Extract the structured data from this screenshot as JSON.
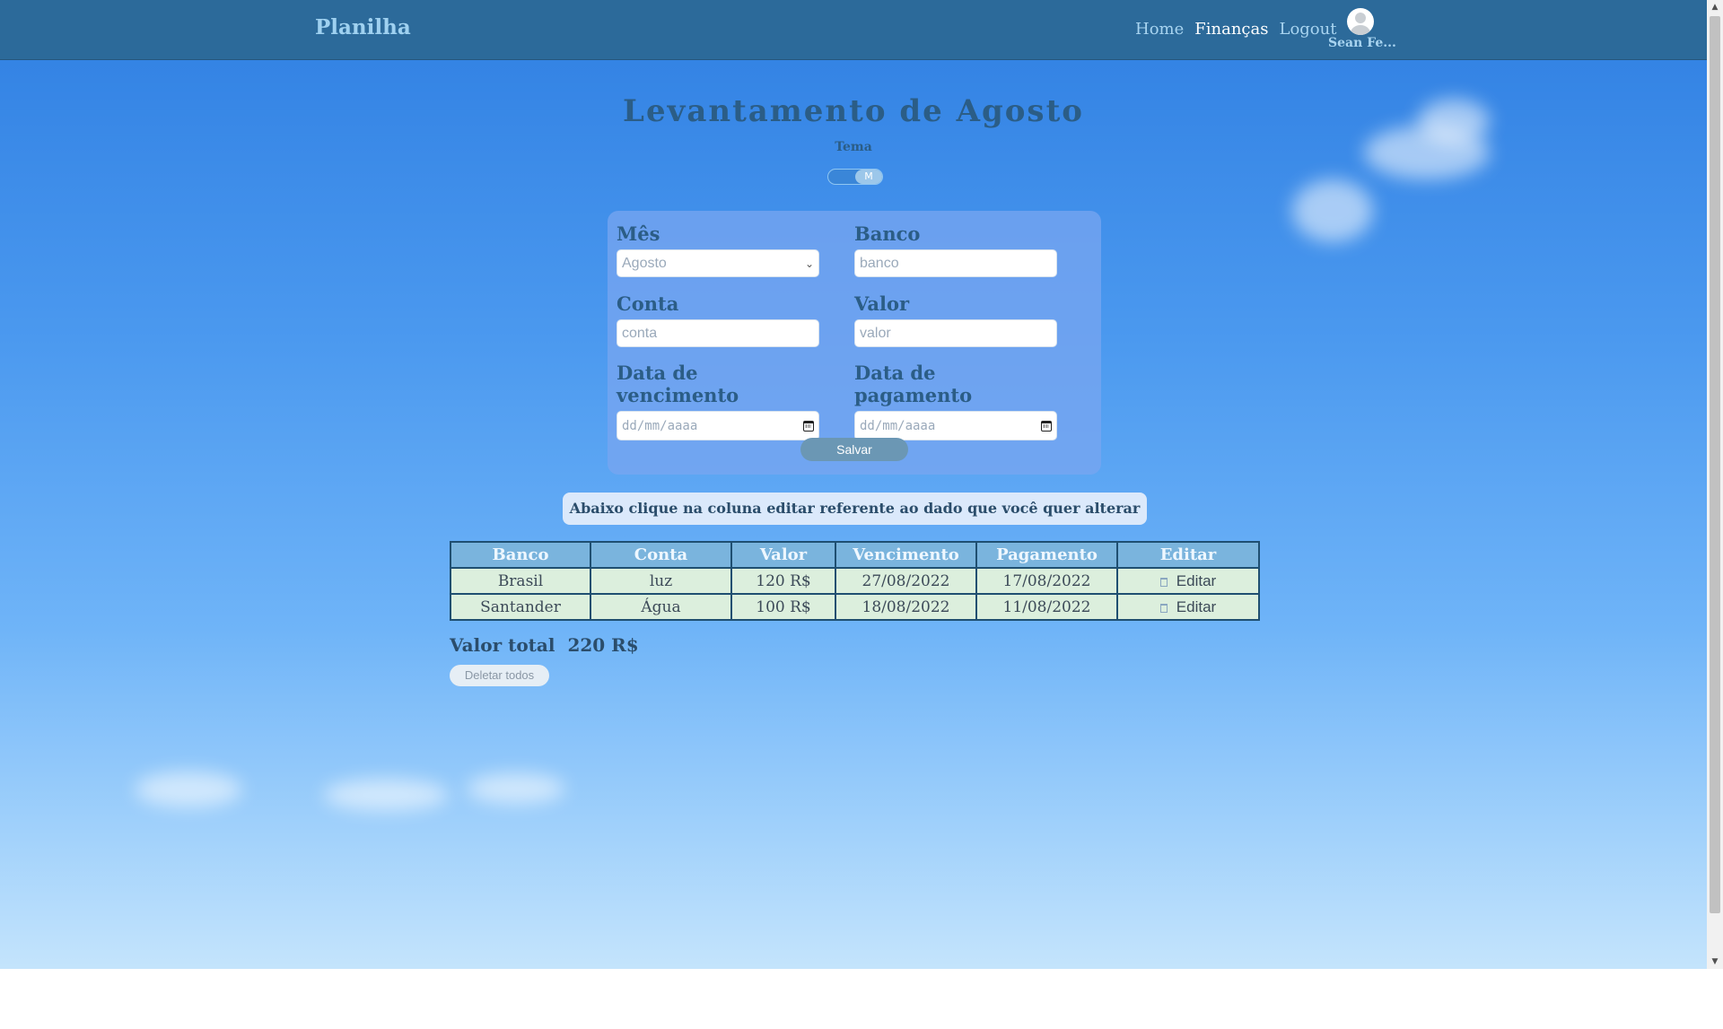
{
  "navbar": {
    "brand": "Planilha",
    "links": [
      "Home",
      "Finanças",
      "Logout"
    ],
    "user_name": "Sean Fe..."
  },
  "page": {
    "title": "Levantamento de Agosto",
    "theme_label": "Tema",
    "theme_toggle_text": "M"
  },
  "form": {
    "month": {
      "label": "Mês",
      "value": "Agosto"
    },
    "bank": {
      "label": "Banco",
      "placeholder": "banco"
    },
    "account": {
      "label": "Conta",
      "placeholder": "conta"
    },
    "value": {
      "label": "Valor",
      "placeholder": "valor"
    },
    "due_date": {
      "label": "Data de vencimento",
      "placeholder": "dd/mm/aaaa"
    },
    "payment_date": {
      "label": "Data de pagamento",
      "placeholder": "dd/mm/aaaa"
    },
    "save_label": "Salvar"
  },
  "hint": "Abaixo clique na coluna editar referente ao dado que você quer alterar",
  "table": {
    "headers": [
      "Banco",
      "Conta",
      "Valor",
      "Vencimento",
      "Pagamento",
      "Editar"
    ],
    "rows": [
      {
        "bank": "Brasil",
        "account": "luz",
        "value": "120 R$",
        "due": "27/08/2022",
        "paid": "17/08/2022",
        "edit": "Editar"
      },
      {
        "bank": "Santander",
        "account": "Água",
        "value": "100 R$",
        "due": "18/08/2022",
        "paid": "11/08/2022",
        "edit": "Editar"
      }
    ]
  },
  "total": {
    "label": "Valor total",
    "value": "220 R$"
  },
  "delete_all_label": "Deletar todos",
  "icons": {
    "calendar": "calendar-icon",
    "trash": "trash-icon",
    "chevron": "chevron-down-icon",
    "avatar": "user-avatar-icon"
  },
  "colors": {
    "navbar": "#2c6a9a",
    "accent": "#2b5d86",
    "table_header": "#7ab4dd",
    "table_cell": "#dcefdd"
  }
}
